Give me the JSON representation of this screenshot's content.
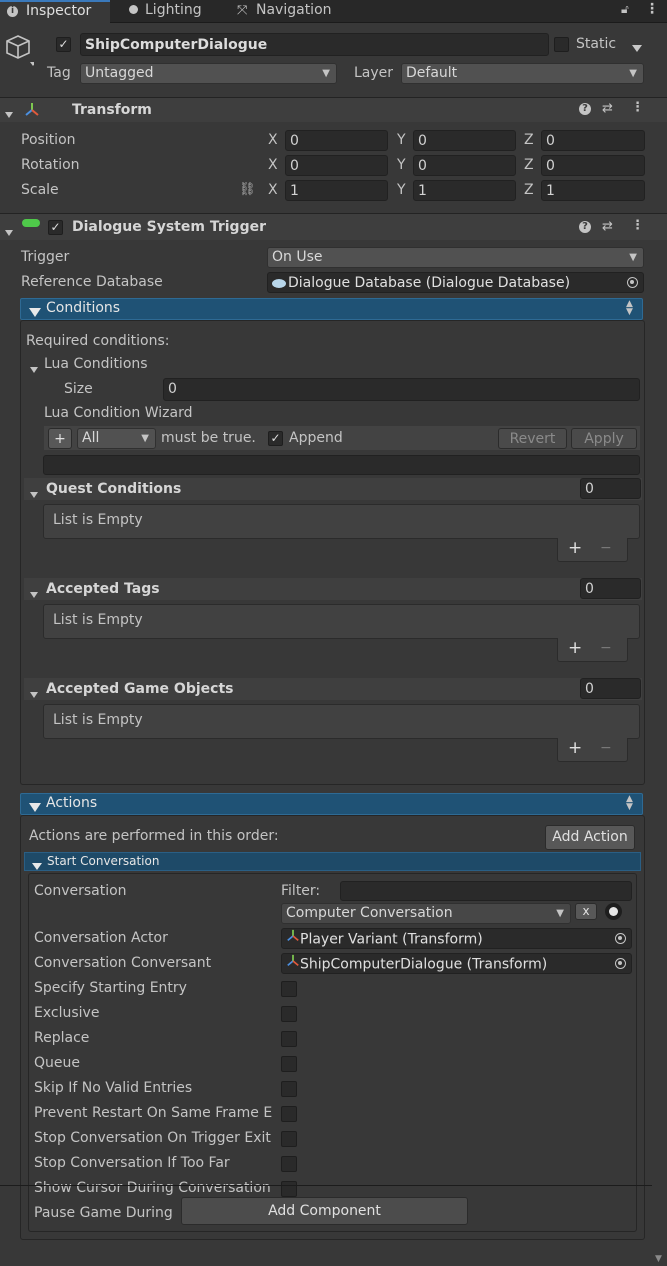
{
  "tabs": [
    {
      "label": "Inspector",
      "icon": "info-icon"
    },
    {
      "label": "Lighting",
      "icon": "bulb-icon"
    },
    {
      "label": "Navigation",
      "icon": "navigation-icon"
    }
  ],
  "gameobject": {
    "name": "ShipComputerDialogue",
    "static_label": "Static",
    "tag_label": "Tag",
    "tag_value": "Untagged",
    "layer_label": "Layer",
    "layer_value": "Default"
  },
  "transform": {
    "title": "Transform",
    "rows": [
      {
        "label": "Position",
        "x": "0",
        "y": "0",
        "z": "0"
      },
      {
        "label": "Rotation",
        "x": "0",
        "y": "0",
        "z": "0"
      },
      {
        "label": "Scale",
        "x": "1",
        "y": "1",
        "z": "1"
      }
    ],
    "axis_x": "X",
    "axis_y": "Y",
    "axis_z": "Z"
  },
  "dst": {
    "title": "Dialogue System Trigger",
    "trigger_label": "Trigger",
    "trigger_value": "On Use",
    "refdb_label": "Reference Database",
    "refdb_value": "Dialogue Database (Dialogue Database)"
  },
  "conditions": {
    "title": "Conditions",
    "required": "Required conditions:",
    "lua_title": "Lua Conditions",
    "size_label": "Size",
    "size_value": "0",
    "wizard_label": "Lua Condition Wizard",
    "plus": "+",
    "all_value": "All",
    "must_be_true": "must be true.",
    "append_label": "Append",
    "revert_label": "Revert",
    "apply_label": "Apply",
    "lists": [
      {
        "title": "Quest Conditions",
        "count": "0",
        "empty": "List is Empty"
      },
      {
        "title": "Accepted Tags",
        "count": "0",
        "empty": "List is Empty"
      },
      {
        "title": "Accepted Game Objects",
        "count": "0",
        "empty": "List is Empty"
      }
    ],
    "add_symbol": "+",
    "remove_symbol": "−"
  },
  "actions": {
    "title": "Actions",
    "order_text": "Actions are performed in this order:",
    "add_action": "Add Action",
    "start_conv": {
      "title": "Start Conversation",
      "conversation_label": "Conversation",
      "filter_label": "Filter:",
      "filter_value": "",
      "conversation_value": "Computer Conversation",
      "clear_label": "x",
      "actor_label": "Conversation Actor",
      "actor_value": "Player Variant (Transform)",
      "conversant_label": "Conversation Conversant",
      "conversant_value": "ShipComputerDialogue (Transform)",
      "toggles": [
        "Specify Starting Entry",
        "Exclusive",
        "Replace",
        "Queue",
        "Skip If No Valid Entries",
        "Prevent Restart On Same Frame E",
        "Stop Conversation On Trigger Exit",
        "Stop Conversation If Too Far",
        "Show Cursor During Conversation",
        "Pause Game During"
      ]
    }
  },
  "add_component": "Add Component"
}
